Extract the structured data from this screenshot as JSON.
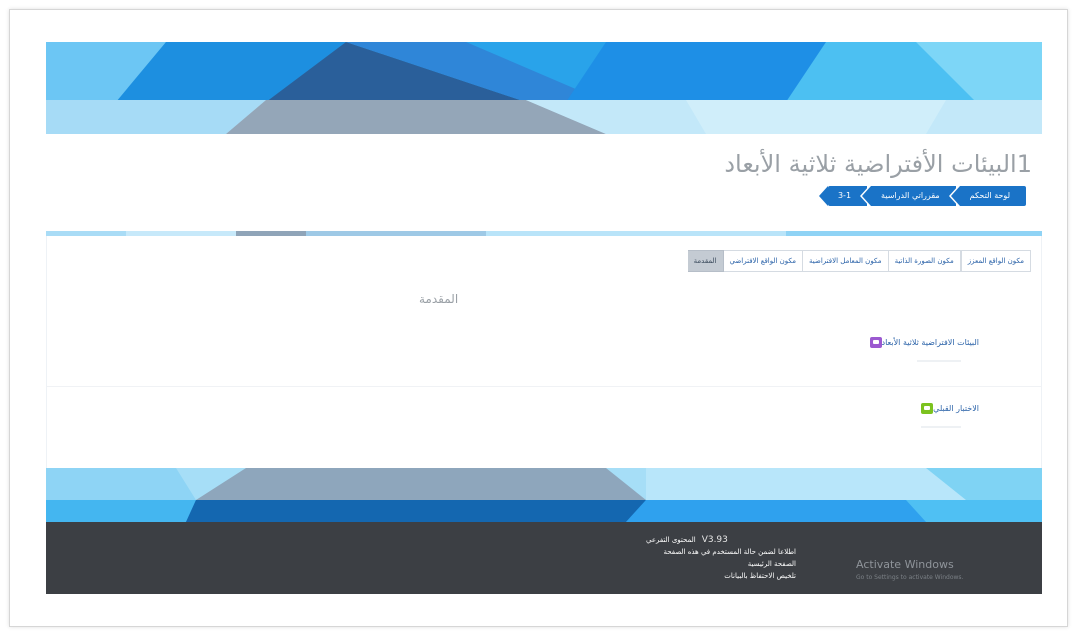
{
  "page": {
    "title": "1البيئات الأفتراضية ثلاثية الأبعاد"
  },
  "breadcrumb": [
    {
      "label": "لوحة التحكم"
    },
    {
      "label": "مقرراتي الدراسية"
    },
    {
      "label": "3-1"
    }
  ],
  "tabs": [
    {
      "label": "المقدمة",
      "active": true
    },
    {
      "label": "مكون الواقع الافتراضي",
      "active": false
    },
    {
      "label": "مكون المعامل الافتراضية",
      "active": false
    },
    {
      "label": "مكون الصورة الذاتية",
      "active": false
    },
    {
      "label": "مكون الواقع المعزز",
      "active": false
    }
  ],
  "main": {
    "section_heading": "المقدمة",
    "activities": [
      {
        "label": "البيئات الافتراضية ثلاثية الأبعاد",
        "icon": "forum-icon",
        "color": "#9b59d0"
      },
      {
        "label": "الاختبار القبلي",
        "icon": "quiz-icon",
        "color": "#7cc21f"
      }
    ]
  },
  "footer": {
    "version": "V3.93",
    "lines": [
      "المحتوى التفرعي",
      "اطلاعا لضمن حالة المستخدم في هذه الصفحة",
      "الصفحة الرئيسية",
      "تلخيص الاحتفاظ بالبيانات"
    ]
  },
  "watermark": {
    "title": "Activate Windows",
    "subtitle": "Go to Settings to activate Windows."
  },
  "colors": {
    "accent": "#1a73c7",
    "banner_light": "#9fd8f5",
    "banner_mid": "#3aa8ec",
    "footer_bg": "#3c3f44"
  }
}
